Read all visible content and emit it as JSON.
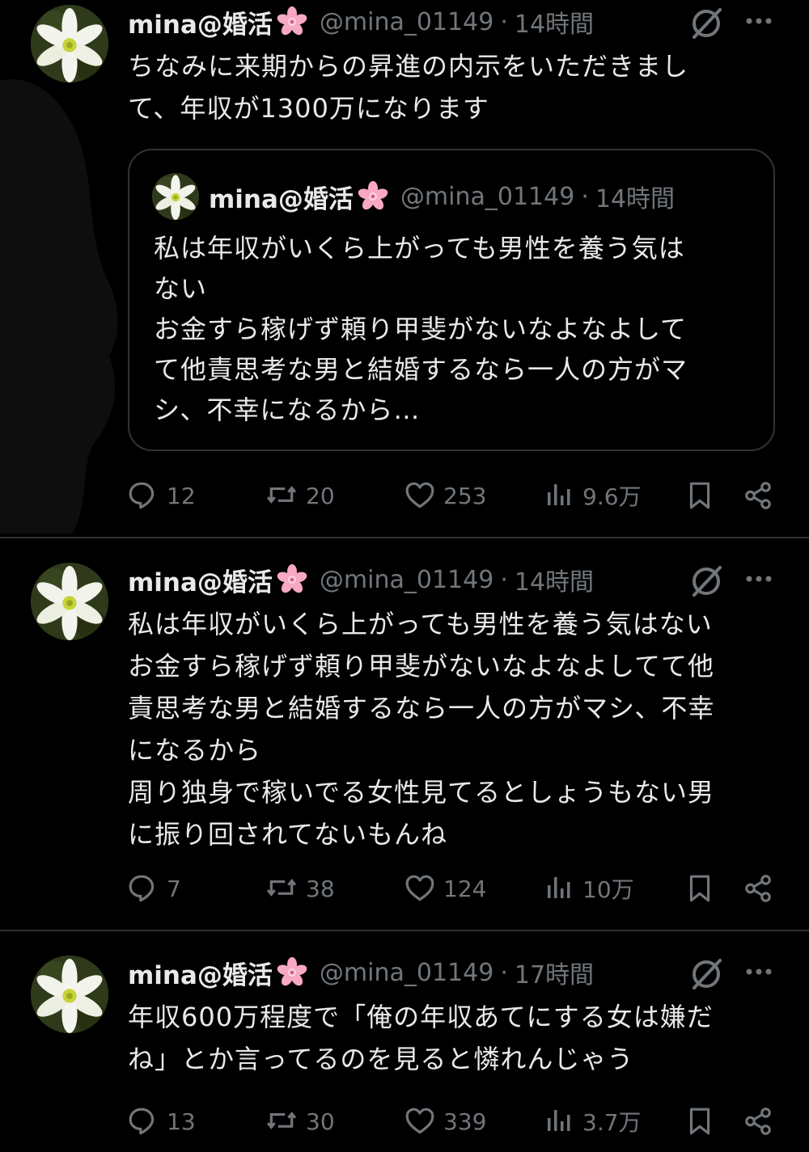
{
  "colors": {
    "background": "#000000",
    "text": "#e7e9ea",
    "muted": "#71767b",
    "divider": "#2f3336"
  },
  "tweets": [
    {
      "display_name": "mina@婚活",
      "name_badge": "cherry-blossom-icon",
      "handle": "@mina_01149",
      "separator": "·",
      "time": "14時間",
      "text": "ちなみに来期からの昇進の内示をいただきまし\nて、年収が1300万になります",
      "quote": {
        "display_name": "mina@婚活",
        "handle": "@mina_01149",
        "separator": "·",
        "time": "14時間",
        "text": "私は年収がいくら上がっても男性を養う気は\nない\nお金すら稼げず頼り甲斐がないなよなよして\nて他責思考な男と結婚するなら一人の方がマ\nシ、不幸になるから…"
      },
      "stats": {
        "replies": "12",
        "retweets": "20",
        "likes": "253",
        "views": "9.6万"
      }
    },
    {
      "display_name": "mina@婚活",
      "name_badge": "cherry-blossom-icon",
      "handle": "@mina_01149",
      "separator": "·",
      "time": "14時間",
      "text": "私は年収がいくら上がっても男性を養う気はない\nお金すら稼げず頼り甲斐がないなよなよしてて他\n責思考な男と結婚するなら一人の方がマシ、不幸\nになるから\n周り独身で稼いでる女性見てるとしょうもない男\nに振り回されてないもんね",
      "stats": {
        "replies": "7",
        "retweets": "38",
        "likes": "124",
        "views": "10万"
      }
    },
    {
      "display_name": "mina@婚活",
      "name_badge": "cherry-blossom-icon",
      "handle": "@mina_01149",
      "separator": "·",
      "time": "17時間",
      "text": "年収600万程度で「俺の年収あてにする女は嫌だ\nね」とか言ってるのを見ると憐れんじゃう",
      "stats": {
        "replies": "13",
        "retweets": "30",
        "likes": "339",
        "views": "3.7万"
      }
    }
  ]
}
